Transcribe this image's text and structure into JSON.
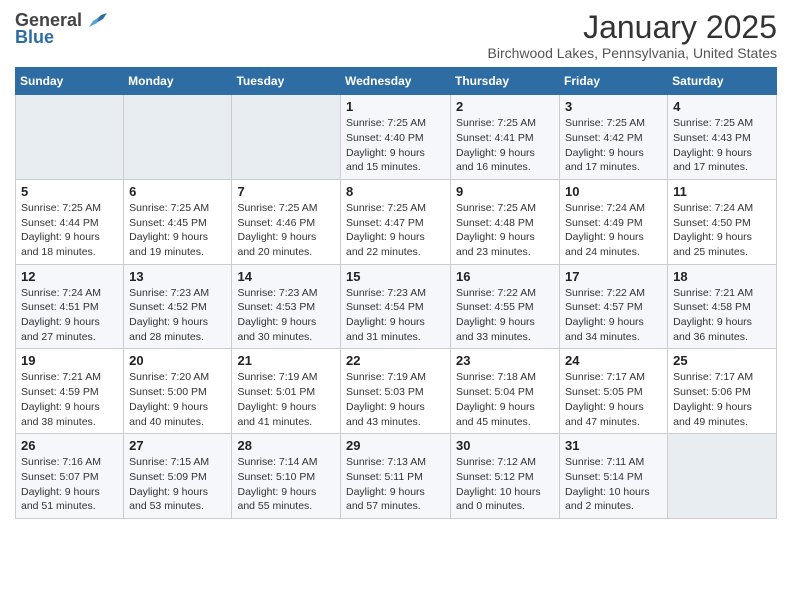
{
  "header": {
    "logo_general": "General",
    "logo_blue": "Blue",
    "month": "January 2025",
    "location": "Birchwood Lakes, Pennsylvania, United States"
  },
  "weekdays": [
    "Sunday",
    "Monday",
    "Tuesday",
    "Wednesday",
    "Thursday",
    "Friday",
    "Saturday"
  ],
  "weeks": [
    [
      {
        "day": "",
        "sunrise": "",
        "sunset": "",
        "daylight": "",
        "empty": true
      },
      {
        "day": "",
        "sunrise": "",
        "sunset": "",
        "daylight": "",
        "empty": true
      },
      {
        "day": "",
        "sunrise": "",
        "sunset": "",
        "daylight": "",
        "empty": true
      },
      {
        "day": "1",
        "sunrise": "Sunrise: 7:25 AM",
        "sunset": "Sunset: 4:40 PM",
        "daylight": "Daylight: 9 hours and 15 minutes.",
        "empty": false
      },
      {
        "day": "2",
        "sunrise": "Sunrise: 7:25 AM",
        "sunset": "Sunset: 4:41 PM",
        "daylight": "Daylight: 9 hours and 16 minutes.",
        "empty": false
      },
      {
        "day": "3",
        "sunrise": "Sunrise: 7:25 AM",
        "sunset": "Sunset: 4:42 PM",
        "daylight": "Daylight: 9 hours and 17 minutes.",
        "empty": false
      },
      {
        "day": "4",
        "sunrise": "Sunrise: 7:25 AM",
        "sunset": "Sunset: 4:43 PM",
        "daylight": "Daylight: 9 hours and 17 minutes.",
        "empty": false
      }
    ],
    [
      {
        "day": "5",
        "sunrise": "Sunrise: 7:25 AM",
        "sunset": "Sunset: 4:44 PM",
        "daylight": "Daylight: 9 hours and 18 minutes.",
        "empty": false
      },
      {
        "day": "6",
        "sunrise": "Sunrise: 7:25 AM",
        "sunset": "Sunset: 4:45 PM",
        "daylight": "Daylight: 9 hours and 19 minutes.",
        "empty": false
      },
      {
        "day": "7",
        "sunrise": "Sunrise: 7:25 AM",
        "sunset": "Sunset: 4:46 PM",
        "daylight": "Daylight: 9 hours and 20 minutes.",
        "empty": false
      },
      {
        "day": "8",
        "sunrise": "Sunrise: 7:25 AM",
        "sunset": "Sunset: 4:47 PM",
        "daylight": "Daylight: 9 hours and 22 minutes.",
        "empty": false
      },
      {
        "day": "9",
        "sunrise": "Sunrise: 7:25 AM",
        "sunset": "Sunset: 4:48 PM",
        "daylight": "Daylight: 9 hours and 23 minutes.",
        "empty": false
      },
      {
        "day": "10",
        "sunrise": "Sunrise: 7:24 AM",
        "sunset": "Sunset: 4:49 PM",
        "daylight": "Daylight: 9 hours and 24 minutes.",
        "empty": false
      },
      {
        "day": "11",
        "sunrise": "Sunrise: 7:24 AM",
        "sunset": "Sunset: 4:50 PM",
        "daylight": "Daylight: 9 hours and 25 minutes.",
        "empty": false
      }
    ],
    [
      {
        "day": "12",
        "sunrise": "Sunrise: 7:24 AM",
        "sunset": "Sunset: 4:51 PM",
        "daylight": "Daylight: 9 hours and 27 minutes.",
        "empty": false
      },
      {
        "day": "13",
        "sunrise": "Sunrise: 7:23 AM",
        "sunset": "Sunset: 4:52 PM",
        "daylight": "Daylight: 9 hours and 28 minutes.",
        "empty": false
      },
      {
        "day": "14",
        "sunrise": "Sunrise: 7:23 AM",
        "sunset": "Sunset: 4:53 PM",
        "daylight": "Daylight: 9 hours and 30 minutes.",
        "empty": false
      },
      {
        "day": "15",
        "sunrise": "Sunrise: 7:23 AM",
        "sunset": "Sunset: 4:54 PM",
        "daylight": "Daylight: 9 hours and 31 minutes.",
        "empty": false
      },
      {
        "day": "16",
        "sunrise": "Sunrise: 7:22 AM",
        "sunset": "Sunset: 4:55 PM",
        "daylight": "Daylight: 9 hours and 33 minutes.",
        "empty": false
      },
      {
        "day": "17",
        "sunrise": "Sunrise: 7:22 AM",
        "sunset": "Sunset: 4:57 PM",
        "daylight": "Daylight: 9 hours and 34 minutes.",
        "empty": false
      },
      {
        "day": "18",
        "sunrise": "Sunrise: 7:21 AM",
        "sunset": "Sunset: 4:58 PM",
        "daylight": "Daylight: 9 hours and 36 minutes.",
        "empty": false
      }
    ],
    [
      {
        "day": "19",
        "sunrise": "Sunrise: 7:21 AM",
        "sunset": "Sunset: 4:59 PM",
        "daylight": "Daylight: 9 hours and 38 minutes.",
        "empty": false
      },
      {
        "day": "20",
        "sunrise": "Sunrise: 7:20 AM",
        "sunset": "Sunset: 5:00 PM",
        "daylight": "Daylight: 9 hours and 40 minutes.",
        "empty": false
      },
      {
        "day": "21",
        "sunrise": "Sunrise: 7:19 AM",
        "sunset": "Sunset: 5:01 PM",
        "daylight": "Daylight: 9 hours and 41 minutes.",
        "empty": false
      },
      {
        "day": "22",
        "sunrise": "Sunrise: 7:19 AM",
        "sunset": "Sunset: 5:03 PM",
        "daylight": "Daylight: 9 hours and 43 minutes.",
        "empty": false
      },
      {
        "day": "23",
        "sunrise": "Sunrise: 7:18 AM",
        "sunset": "Sunset: 5:04 PM",
        "daylight": "Daylight: 9 hours and 45 minutes.",
        "empty": false
      },
      {
        "day": "24",
        "sunrise": "Sunrise: 7:17 AM",
        "sunset": "Sunset: 5:05 PM",
        "daylight": "Daylight: 9 hours and 47 minutes.",
        "empty": false
      },
      {
        "day": "25",
        "sunrise": "Sunrise: 7:17 AM",
        "sunset": "Sunset: 5:06 PM",
        "daylight": "Daylight: 9 hours and 49 minutes.",
        "empty": false
      }
    ],
    [
      {
        "day": "26",
        "sunrise": "Sunrise: 7:16 AM",
        "sunset": "Sunset: 5:07 PM",
        "daylight": "Daylight: 9 hours and 51 minutes.",
        "empty": false
      },
      {
        "day": "27",
        "sunrise": "Sunrise: 7:15 AM",
        "sunset": "Sunset: 5:09 PM",
        "daylight": "Daylight: 9 hours and 53 minutes.",
        "empty": false
      },
      {
        "day": "28",
        "sunrise": "Sunrise: 7:14 AM",
        "sunset": "Sunset: 5:10 PM",
        "daylight": "Daylight: 9 hours and 55 minutes.",
        "empty": false
      },
      {
        "day": "29",
        "sunrise": "Sunrise: 7:13 AM",
        "sunset": "Sunset: 5:11 PM",
        "daylight": "Daylight: 9 hours and 57 minutes.",
        "empty": false
      },
      {
        "day": "30",
        "sunrise": "Sunrise: 7:12 AM",
        "sunset": "Sunset: 5:12 PM",
        "daylight": "Daylight: 10 hours and 0 minutes.",
        "empty": false
      },
      {
        "day": "31",
        "sunrise": "Sunrise: 7:11 AM",
        "sunset": "Sunset: 5:14 PM",
        "daylight": "Daylight: 10 hours and 2 minutes.",
        "empty": false
      },
      {
        "day": "",
        "sunrise": "",
        "sunset": "",
        "daylight": "",
        "empty": true
      }
    ]
  ]
}
